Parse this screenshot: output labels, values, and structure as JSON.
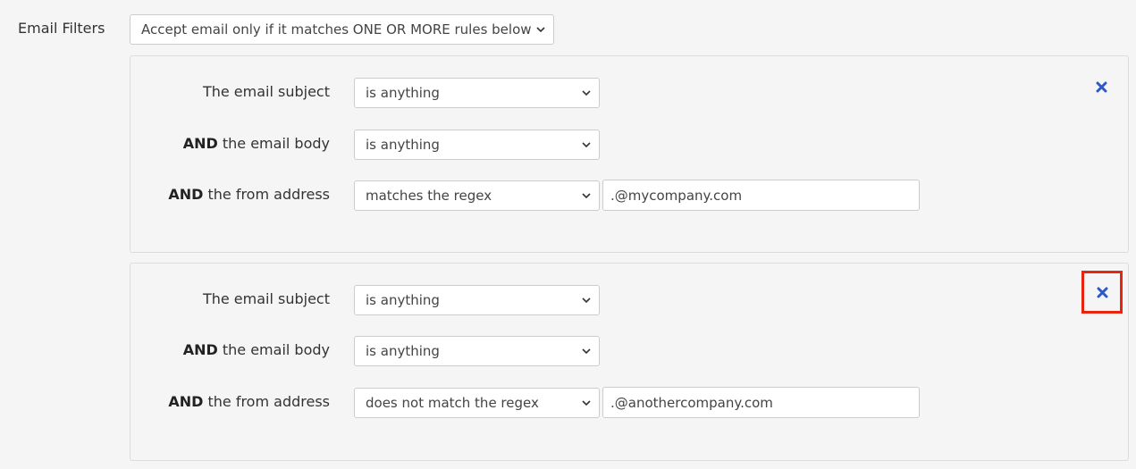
{
  "filters": {
    "label": "Email Filters",
    "mode_select": "Accept email only if it matches ONE OR MORE rules below"
  },
  "rules": [
    {
      "subject_label": "The email subject",
      "subject_op": "is anything",
      "body_label_bold": "AND",
      "body_label_rest": " the email body",
      "body_op": "is anything",
      "from_label_bold": "AND",
      "from_label_rest": " the from address",
      "from_op": "matches the regex",
      "from_value": ".@mycompany.com",
      "remove_icon": "close-icon"
    },
    {
      "subject_label": "The email subject",
      "subject_op": "is anything",
      "body_label_bold": "AND",
      "body_label_rest": " the email body",
      "body_op": "is anything",
      "from_label_bold": "AND",
      "from_label_rest": " the from address",
      "from_op": "does not match the regex",
      "from_value": ".@anothercompany.com",
      "remove_icon": "close-icon",
      "highlighted": true
    }
  ],
  "colors": {
    "background": "#f5f5f5",
    "remove_icon": "#2e57c9",
    "highlight_border": "#e8230e"
  }
}
